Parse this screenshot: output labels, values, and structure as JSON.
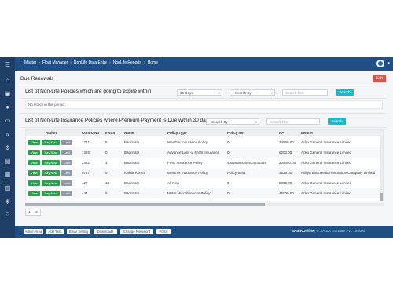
{
  "breadcrumb": [
    "Master",
    "Float Manager",
    "NonLife Data Entry",
    "NonLife Reports",
    "Home"
  ],
  "page_title": "Due Renewals",
  "exit_label": "Exit",
  "section1": {
    "title": "List of Non-Life Policies which are going to expire within",
    "period_select": "30 Days",
    "searchby_select": "--Search By--",
    "search_placeholder": "Search Text",
    "search_label": "Search",
    "empty_message": "No Policy in this period"
  },
  "section2": {
    "title": "List of Non-Life Insurance Policies where Premium Payment is Due within 30 days",
    "searchby_select": "--Search By--",
    "search_placeholder": "Search Text",
    "search_label": "Search"
  },
  "table": {
    "headers": [
      "Action",
      "ControlNo",
      "Insttn",
      "Name",
      "Policy Type",
      "Policy No",
      "NP",
      "Insurer"
    ],
    "action_labels": {
      "view": "View",
      "pay": "Pay Now",
      "last": "Last"
    },
    "rows": [
      {
        "control": "1741",
        "insttn": "6",
        "name": "Badrinath",
        "type": "Weather Insurance Policy",
        "policy_no": "0",
        "np": "34560.00",
        "insurer": "Acko General Insurance Limited"
      },
      {
        "control": "1365",
        "insttn": "0",
        "name": "Badrinath",
        "type": "Advance Loss of Profit Insurance",
        "policy_no": "0",
        "np": "6200.00",
        "insurer": "Acko General Insurance Limited"
      },
      {
        "control": "2462",
        "insttn": "3",
        "name": "Badrinath",
        "type": "FIRE Insurance Policy",
        "policy_no": "43526364364634646346",
        "np": "209450.00",
        "insurer": "Acko General Insurance Limited"
      },
      {
        "control": "5727",
        "insttn": "9",
        "name": "Kishor Kumar",
        "type": "Weather Insurance Policy",
        "policy_no": "Policy-8541",
        "np": "3836.00",
        "insurer": "Aditya Birla Health Insurance Company Limited"
      },
      {
        "control": "427",
        "insttn": "13",
        "name": "Badrinath",
        "type": "All Risk",
        "policy_no": "0",
        "np": "8000.00",
        "insurer": "Acko General Insurance Limited"
      },
      {
        "control": "444",
        "insttn": "5",
        "name": "Badrinath",
        "type": "Motor Miscellaneous Policy",
        "policy_no": "0",
        "np": "45000.00",
        "insurer": "Acko General Insurance Limited"
      }
    ]
  },
  "pager": [
    "1",
    "2"
  ],
  "footer": {
    "buttons": [
      "Admin Area",
      "Add Task",
      "Email Setting",
      "Downloads",
      "Change Password",
      "Portal"
    ],
    "brand": "SAIBAOnline",
    "copyright": "| © SAIBA Software Pvt. Limited"
  },
  "colors": {
    "nav": "#1f4f84",
    "sidebar": "#1f3f66",
    "exit": "#d9534f",
    "search": "#21b6c9",
    "action_green": "#2e9e4f"
  }
}
